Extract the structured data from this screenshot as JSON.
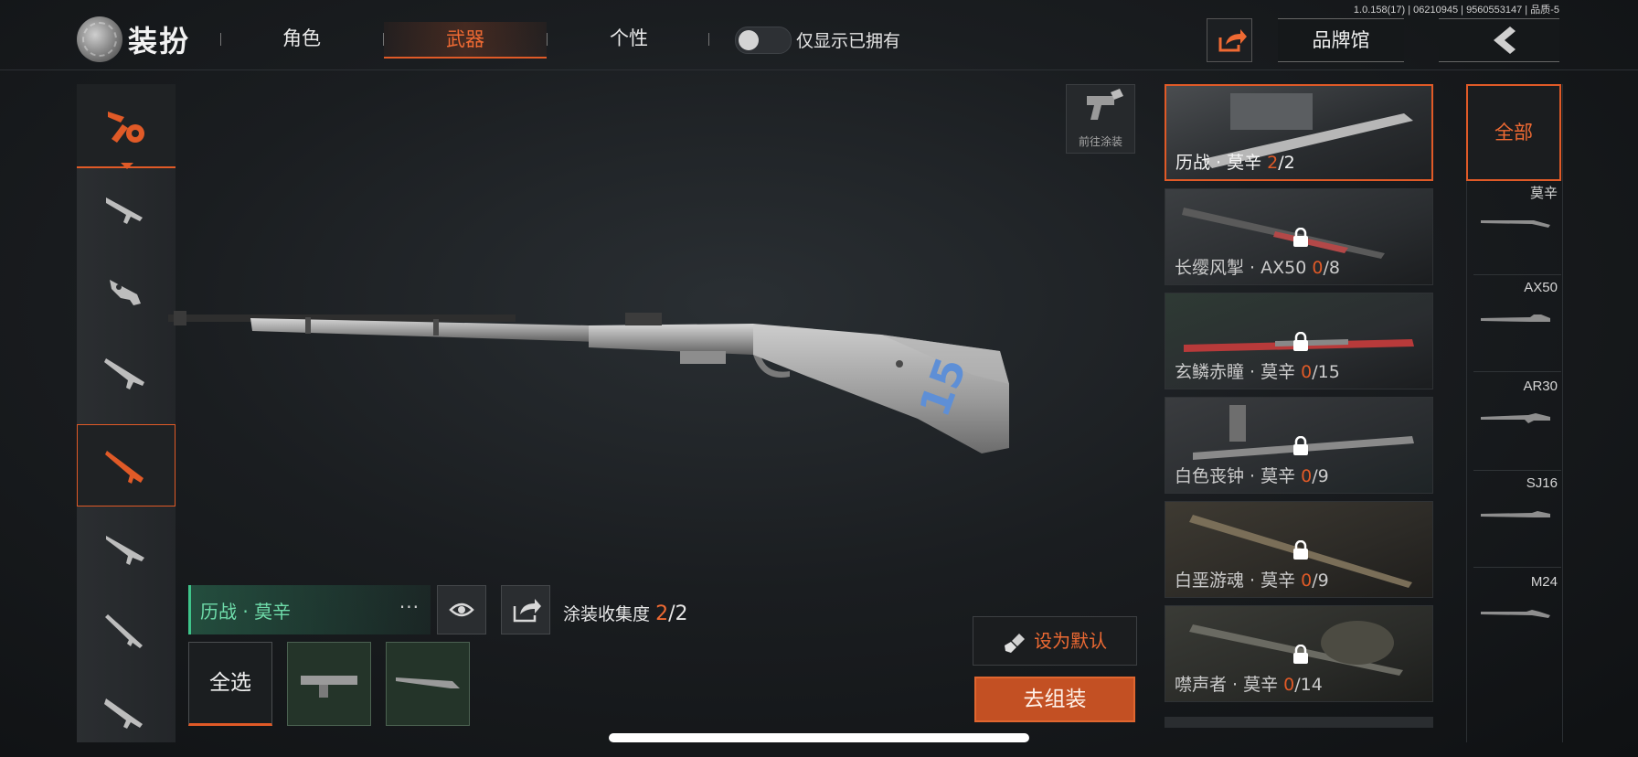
{
  "version_text": "1.0.158(17) | 06210945 | 9560553147 | 品质-5",
  "header": {
    "title": "装扮",
    "tabs": [
      {
        "label": "角色",
        "active": false
      },
      {
        "label": "武器",
        "active": true
      },
      {
        "label": "个性",
        "active": false
      }
    ],
    "toggle_label": "仅显示已拥有",
    "toggle_on": false,
    "brand_button": "品牌馆"
  },
  "viewport": {
    "goto_paint_label": "前往涂装",
    "rifle_marking": "15"
  },
  "current_skin": {
    "name": "历战 · 莫辛",
    "more": "···",
    "collection_label": "涂装收集度",
    "collection_current": "2",
    "collection_total": "/2",
    "select_all": "全选"
  },
  "actions": {
    "set_default": "设为默认",
    "go_assemble": "去组装"
  },
  "skins": [
    {
      "name": "历战 · 莫辛 ",
      "owned": "2",
      "total": "/2",
      "locked": false,
      "selected": true
    },
    {
      "name": "长缨风掣 · AX50 ",
      "owned": "0",
      "total": "/8",
      "locked": true,
      "selected": false
    },
    {
      "name": "玄鳞赤瞳 · 莫辛 ",
      "owned": "0",
      "total": "/15",
      "locked": true,
      "selected": false
    },
    {
      "name": "白色丧钟 · 莫辛 ",
      "owned": "0",
      "total": "/9",
      "locked": true,
      "selected": false
    },
    {
      "name": "白垩游魂 · 莫辛 ",
      "owned": "0",
      "total": "/9",
      "locked": true,
      "selected": false
    },
    {
      "name": "噤声者 · 莫辛 ",
      "owned": "0",
      "total": "/14",
      "locked": true,
      "selected": false
    }
  ],
  "filters": {
    "all": "全部",
    "items": [
      "莫辛",
      "AX50",
      "AR30",
      "SJ16",
      "M24"
    ]
  },
  "colors": {
    "accent": "#e05a27",
    "accent_text": "#ef6a33",
    "skin_green": "#6fdcaa"
  }
}
